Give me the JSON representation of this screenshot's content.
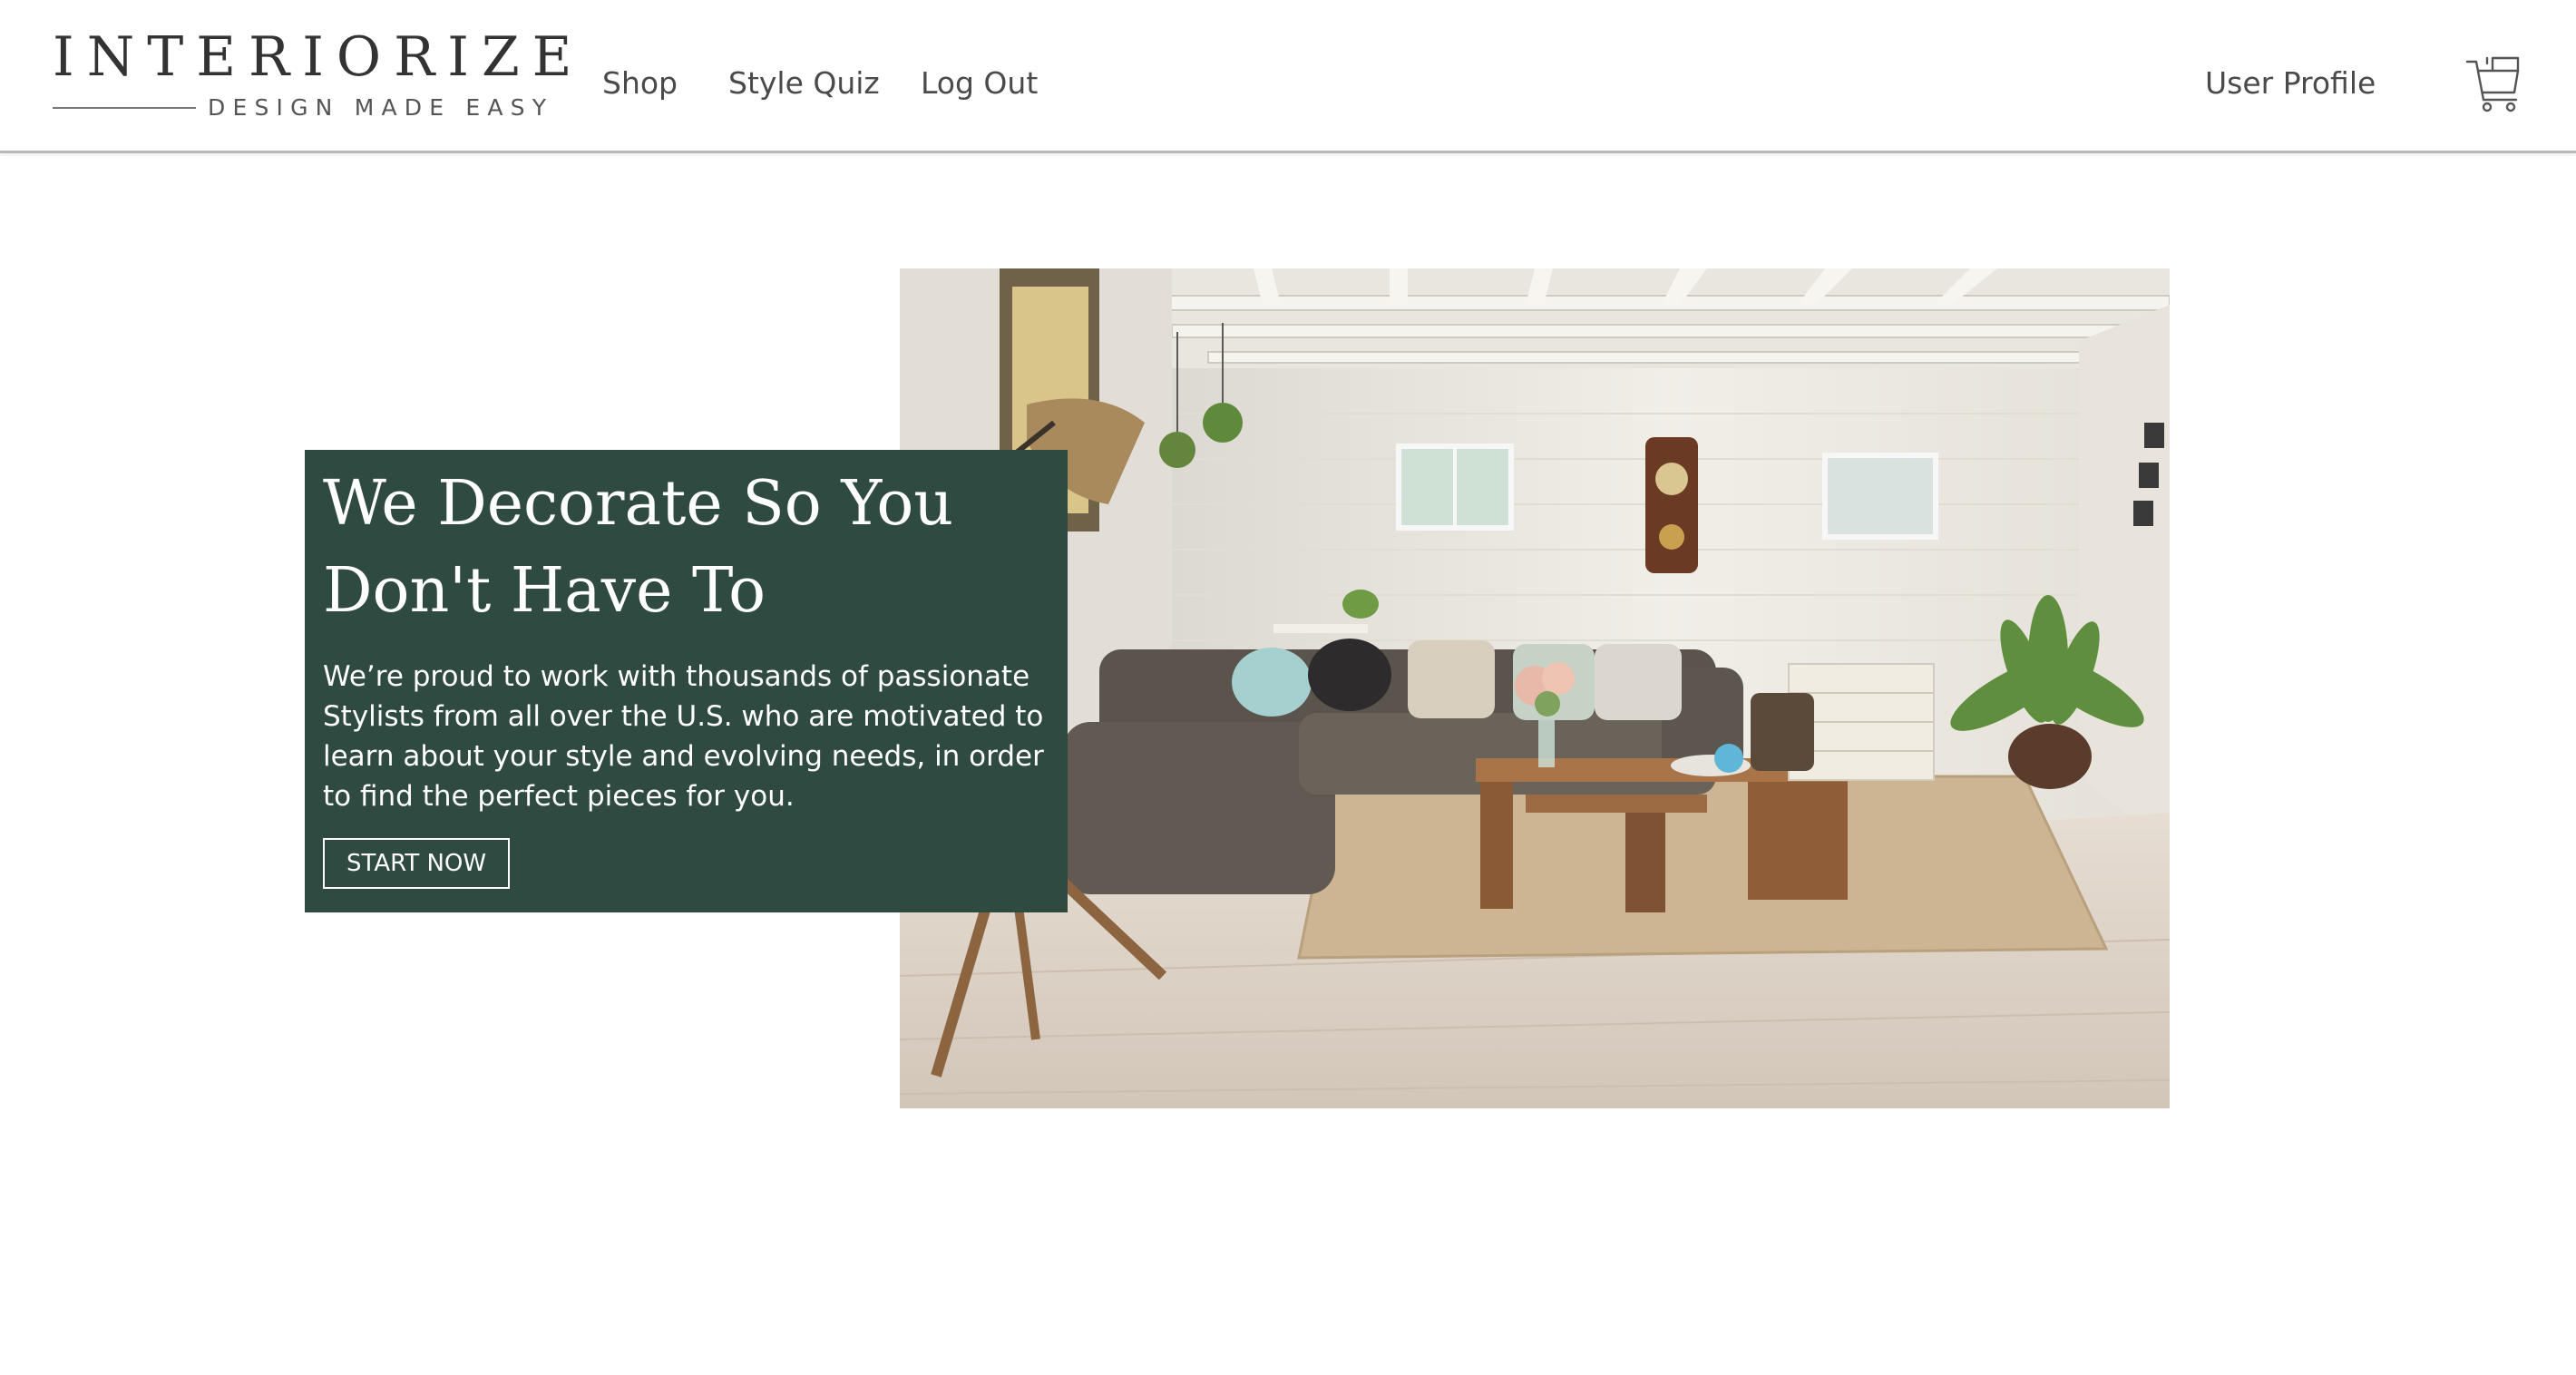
{
  "brand": {
    "name": "INTERIORIZE",
    "tagline": "DESIGN MADE EASY"
  },
  "nav": {
    "shop": "Shop",
    "style_quiz": "Style Quiz",
    "log_out": "Log Out",
    "user_profile": "User Profile",
    "cart_icon": "shopping-cart-icon"
  },
  "hero": {
    "title": "We Decorate So You Don't Have To",
    "description": "We’re proud to work with thousands of passionate Stylists from all over the U.S. who are motivated to learn about your style and evolving needs, in order to find the perfect pieces for you.",
    "button_label": "START NOW",
    "image_subject": "living-room-photo"
  },
  "colors": {
    "card_background": "#2f4a40",
    "text_dark": "#333333",
    "nav_text": "#4a4a4a",
    "header_border": "#b9b9b9"
  }
}
